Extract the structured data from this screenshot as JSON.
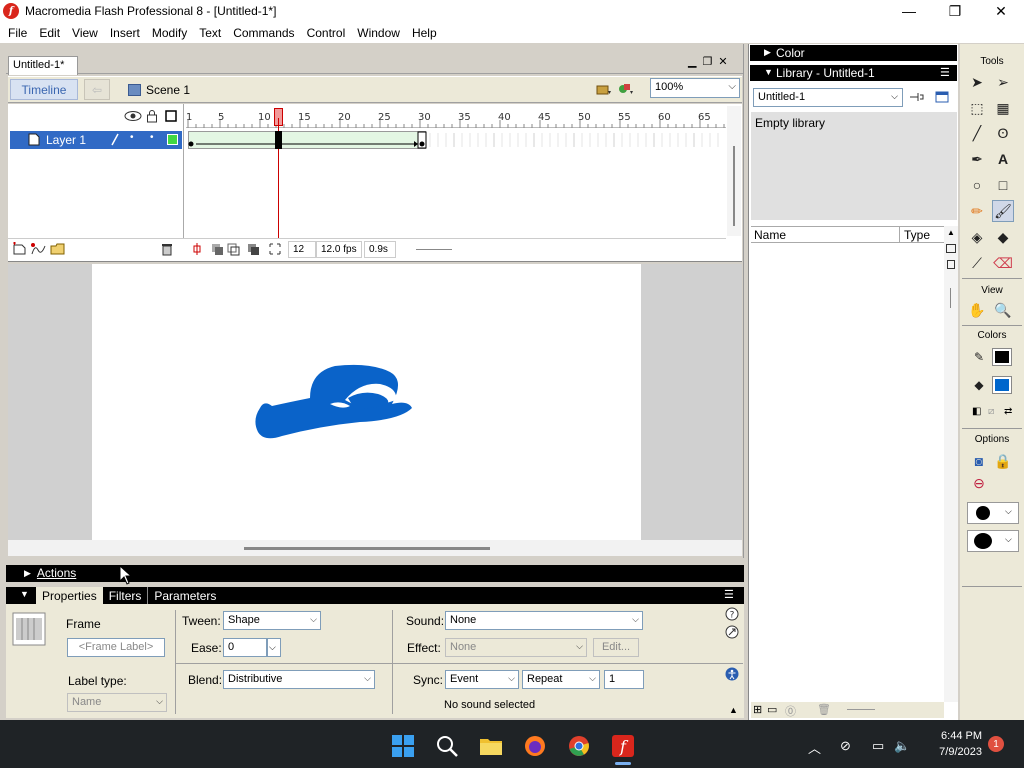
{
  "window": {
    "title": "Macromedia Flash Professional 8 - [Untitled-1*]",
    "minimize_label": "—",
    "maximize_label": "❐",
    "close_label": "✕"
  },
  "menu": [
    "File",
    "Edit",
    "View",
    "Insert",
    "Modify",
    "Text",
    "Commands",
    "Control",
    "Window",
    "Help"
  ],
  "document": {
    "tab_label": "Untitled-1*",
    "timeline_button": "Timeline",
    "scene_label": "Scene 1",
    "zoom": "100%"
  },
  "timeline": {
    "layer_name": "Layer 1",
    "ruler_ticks": [
      "1",
      "5",
      "10",
      "15",
      "20",
      "25",
      "30",
      "35",
      "40",
      "45",
      "50",
      "55",
      "60",
      "65"
    ],
    "current_frame": "12",
    "frame_rate": "12.0 fps",
    "elapsed_time": "0.9s"
  },
  "panels": {
    "actions_label": "Actions",
    "properties_tab": "Properties",
    "filters_tab": "Filters",
    "parameters_tab": "Parameters"
  },
  "properties": {
    "frame_label": "Frame",
    "frame_label_placeholder": "<Frame Label>",
    "label_type_label": "Label type:",
    "label_type_value": "Name",
    "tween_label": "Tween:",
    "tween_value": "Shape",
    "ease_label": "Ease:",
    "ease_value": "0",
    "blend_label": "Blend:",
    "blend_value": "Distributive",
    "sound_label": "Sound:",
    "sound_value": "None",
    "effect_label": "Effect:",
    "effect_value": "None",
    "edit_button": "Edit...",
    "sync_label": "Sync:",
    "sync_value": "Event",
    "repeat_value": "Repeat",
    "repeat_count": "1",
    "sound_status": "No sound selected"
  },
  "right_panels": {
    "color_title": "Color",
    "library_title": "Library - Untitled-1",
    "library_select": "Untitled-1",
    "library_empty": "Empty library",
    "col_name": "Name",
    "col_type": "Type"
  },
  "tools": {
    "title": "Tools",
    "view_title": "View",
    "colors_title": "Colors",
    "options_title": "Options",
    "stroke_color": "#000000",
    "fill_color": "#0066cc"
  },
  "taskbar": {
    "time": "6:44 PM",
    "date": "7/9/2023",
    "notification_count": "1"
  },
  "stage": {
    "shape_color": "#0a63c9"
  }
}
